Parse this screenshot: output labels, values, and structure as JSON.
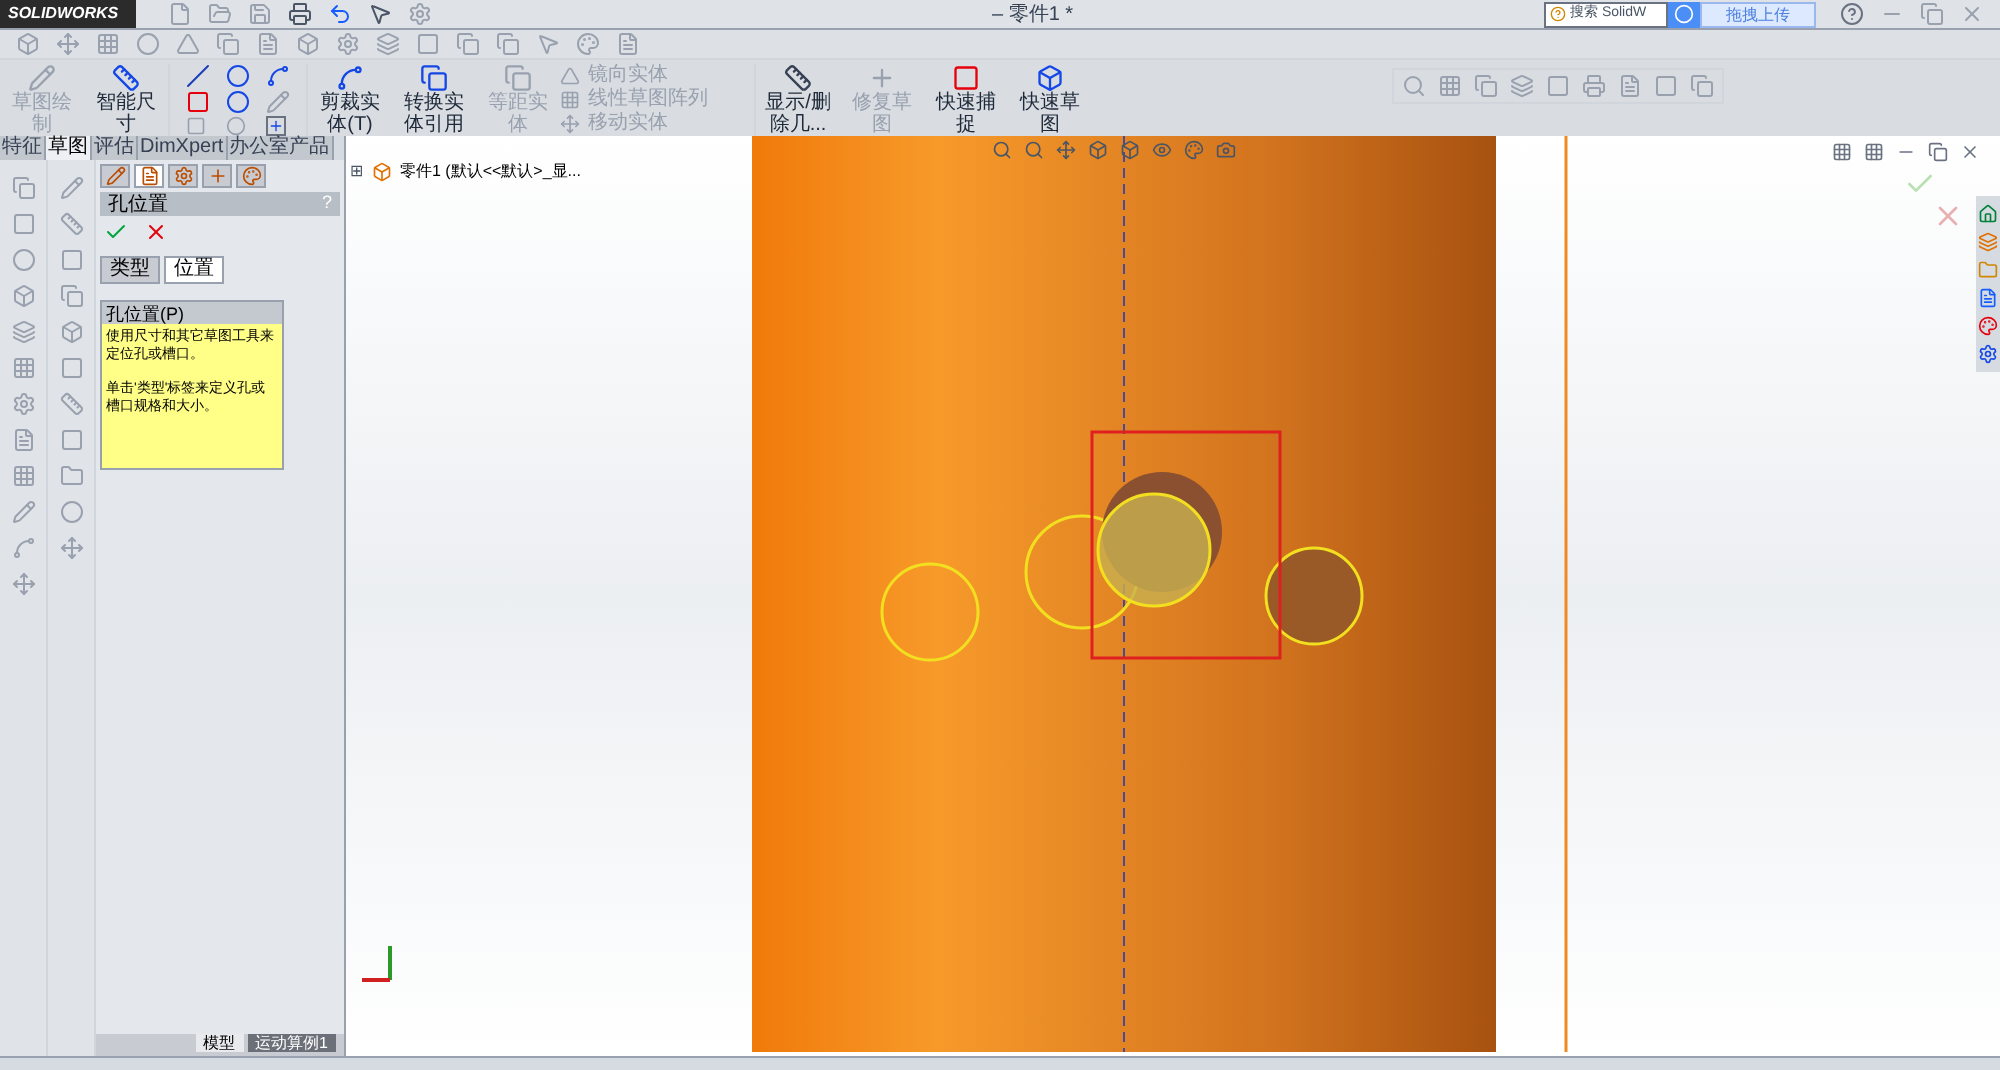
{
  "app": {
    "logo": "SOLIDWORKS",
    "title": "– 零件1 *"
  },
  "search": {
    "placeholder": "搜索 SolidW"
  },
  "upload_button": "拖拽上传",
  "ribbon": {
    "large_buttons": [
      {
        "label": "草图绘制",
        "disabled": true
      },
      {
        "label": "智能尺寸",
        "disabled": false
      }
    ],
    "edit_buttons": [
      {
        "label": "剪裁实体(T)",
        "disabled": false
      },
      {
        "label": "转换实体引用",
        "disabled": false
      },
      {
        "label": "等距实体",
        "disabled": true
      }
    ],
    "small_items": [
      {
        "label": "镜向实体"
      },
      {
        "label": "线性草图阵列"
      },
      {
        "label": "移动实体"
      }
    ],
    "tail_buttons": [
      {
        "label": "显示/删除几...",
        "disabled": false
      },
      {
        "label": "修复草图",
        "disabled": true
      },
      {
        "label": "快速捕捉",
        "disabled": false
      },
      {
        "label": "快速草图",
        "disabled": false
      }
    ]
  },
  "command_tabs": [
    {
      "label": "特征",
      "selected": false
    },
    {
      "label": "草图",
      "selected": true
    },
    {
      "label": "评估",
      "selected": false
    },
    {
      "label": "DimXpert",
      "selected": false
    },
    {
      "label": "办公室产品",
      "selected": false
    }
  ],
  "property_manager": {
    "manager_tabs": [
      {
        "selected": false
      },
      {
        "selected": true
      },
      {
        "selected": false
      },
      {
        "selected": false
      },
      {
        "selected": false
      }
    ],
    "title": "孔位置",
    "help": "?",
    "tabs": [
      {
        "label": "类型",
        "selected": false
      },
      {
        "label": "位置",
        "selected": true
      }
    ],
    "group": {
      "title": "孔位置(P)",
      "paragraphs": [
        "使用尺寸和其它草图工具来定位孔或槽口。",
        "单击'类型'标签来定义孔或槽口规格和大小。"
      ]
    }
  },
  "feature_tree": {
    "expander": "⊞",
    "root": "零件1 (默认<<默认>_显..."
  },
  "bottom_tabs": [
    {
      "label": "模型",
      "selected": false
    },
    {
      "label": "运动算例1",
      "selected": true
    }
  ]
}
